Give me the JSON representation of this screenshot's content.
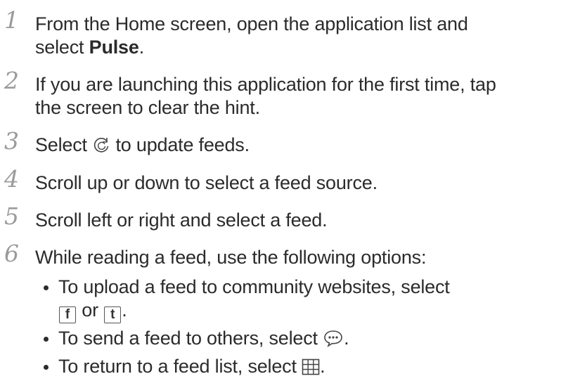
{
  "steps": [
    {
      "number": "1",
      "line1": "From the Home screen, open the application list and",
      "line2_pre": "select ",
      "line2_bold": "Pulse",
      "line2_post": "."
    },
    {
      "number": "2",
      "line1": "If you are launching this application for the first time, tap",
      "line2": "the screen to clear the hint."
    },
    {
      "number": "3",
      "pre": "Select ",
      "post": " to update feeds.",
      "icon": "refresh-icon"
    },
    {
      "number": "4",
      "text": "Scroll up or down to select a feed source."
    },
    {
      "number": "5",
      "text": "Scroll left or right and select a feed."
    },
    {
      "number": "6",
      "text": "While reading a feed, use the following options:"
    }
  ],
  "options": [
    {
      "line1": "To upload a feed to community websites, select",
      "connector": " or ",
      "end": ".",
      "icons": [
        "facebook-icon",
        "twitter-icon"
      ]
    },
    {
      "pre": "To send a feed to others, select ",
      "post": ".",
      "icon": "message-bubble-icon"
    },
    {
      "pre": "To return to a feed list, select ",
      "post": ".",
      "icon": "grid-icon"
    }
  ],
  "icon_glyphs": {
    "facebook": "f",
    "twitter": "t"
  },
  "colors": {
    "text": "#2b2b2b",
    "step_number": "#9b9b9b"
  }
}
